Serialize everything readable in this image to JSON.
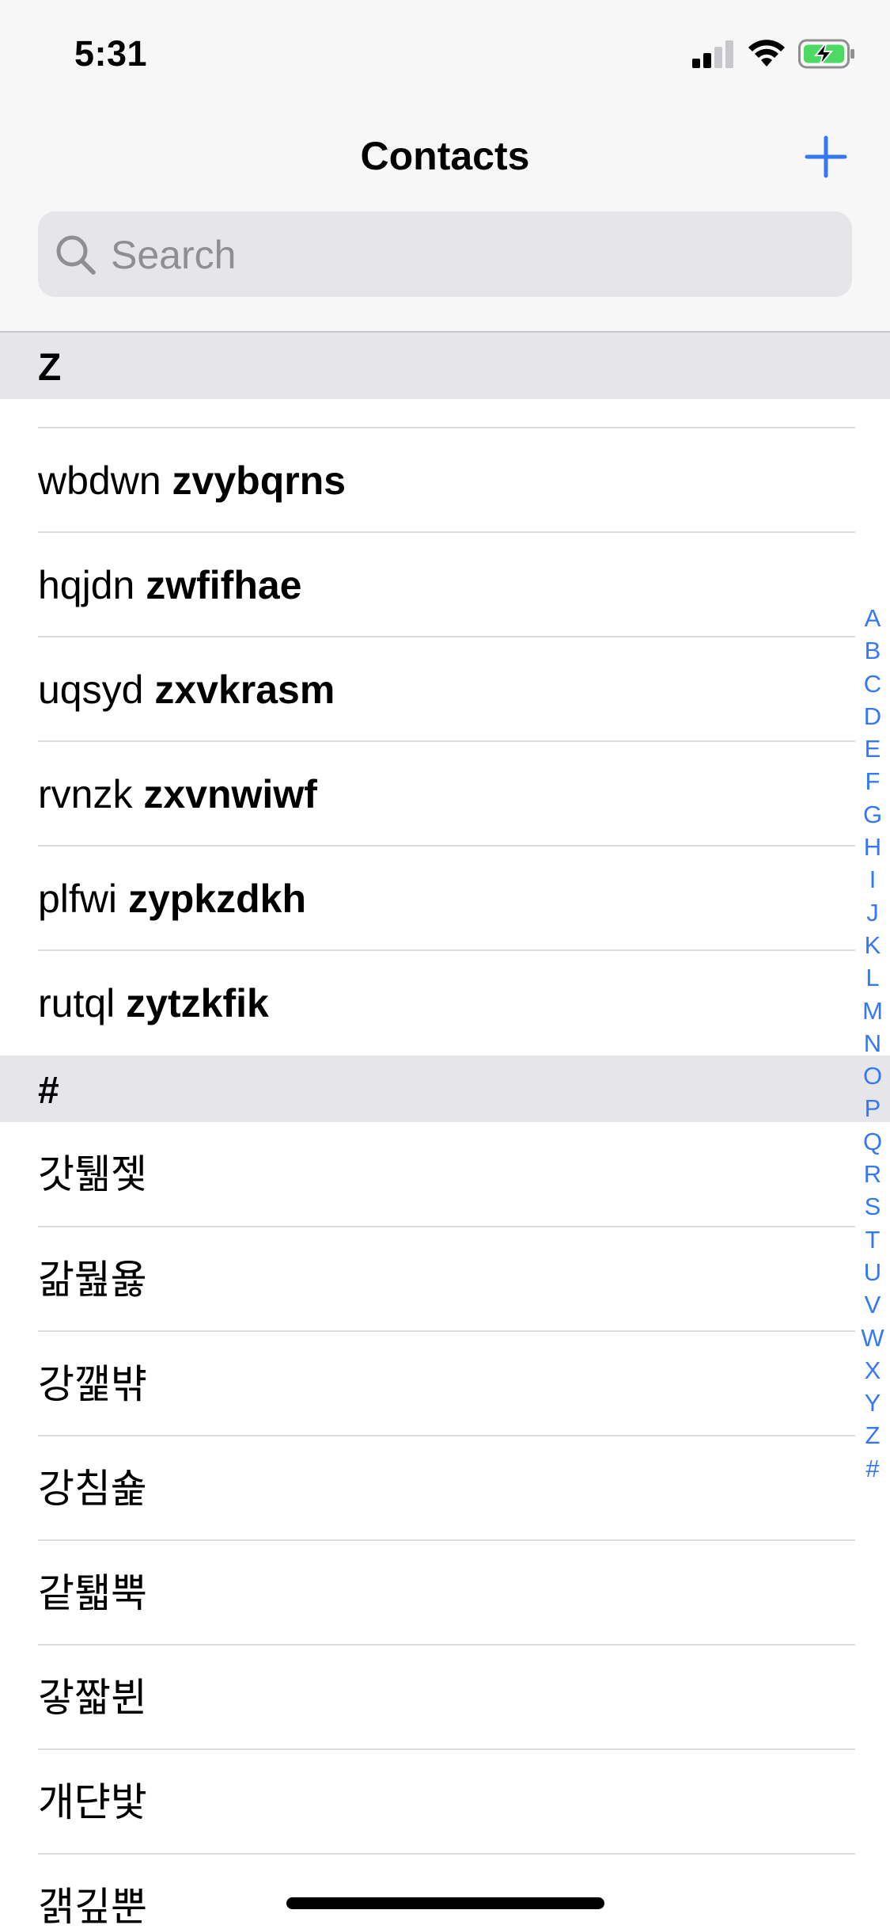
{
  "status_bar": {
    "time": "5:31"
  },
  "nav": {
    "title": "Contacts"
  },
  "search": {
    "placeholder": "Search"
  },
  "sections": [
    {
      "header": "Z",
      "rows": [
        {
          "first": "wbdwn",
          "last": "zvybqrns"
        },
        {
          "first": "hqjdn",
          "last": "zwfifhae"
        },
        {
          "first": "uqsyd",
          "last": "zxvkrasm"
        },
        {
          "first": "rvnzk",
          "last": "zxvnwiwf"
        },
        {
          "first": "plfwi",
          "last": "zypkzdkh"
        },
        {
          "first": "rutql",
          "last": "zytzkfik"
        }
      ]
    },
    {
      "header": "#",
      "rows": [
        {
          "name": "갓퉮젳"
        },
        {
          "name": "갊뭞욣"
        },
        {
          "name": "강깵뱎"
        },
        {
          "name": "강침숉"
        },
        {
          "name": "같퇣뿍"
        },
        {
          "name": "갛짧뷘"
        },
        {
          "name": "개댠밫"
        },
        {
          "name": "갥깊뿐"
        }
      ]
    }
  ],
  "index_letters": [
    "A",
    "B",
    "C",
    "D",
    "E",
    "F",
    "G",
    "H",
    "I",
    "J",
    "K",
    "L",
    "M",
    "N",
    "O",
    "P",
    "Q",
    "R",
    "S",
    "T",
    "U",
    "V",
    "W",
    "X",
    "Y",
    "Z",
    "#"
  ],
  "colors": {
    "accent": "#3478f6",
    "section_bg": "#e5e5ea",
    "header_bg": "#f7f7f7"
  }
}
